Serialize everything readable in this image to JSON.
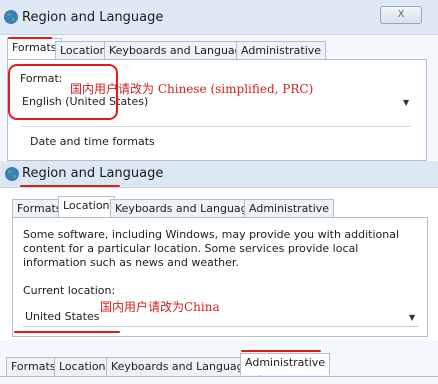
{
  "dialog": {
    "title": "Region and Language",
    "close_label": "X",
    "tabs": [
      "Formats",
      "Location",
      "Keyboards and Languages",
      "Administrative"
    ]
  },
  "formats_panel": {
    "format_label": "Format:",
    "format_value": "English (United States)",
    "date_time_heading": "Date and time formats",
    "annotation": "国内用户请改为 Chinese (simplified, PRC)"
  },
  "location_panel": {
    "description": "Some software, including Windows, may provide you with additional content for a particular location. Some services provide local information such as news and weather.",
    "current_location_label": "Current location:",
    "current_location_value": "United States",
    "annotation": "国内用户请改为China"
  },
  "colors": {
    "annotation_red": "#e21a1a",
    "titlebar": "#dfe9f5",
    "tab_border": "#b3bfcc"
  },
  "icons": {
    "window_icon": "globe-icon",
    "dropdown": "chevron-down-icon"
  }
}
